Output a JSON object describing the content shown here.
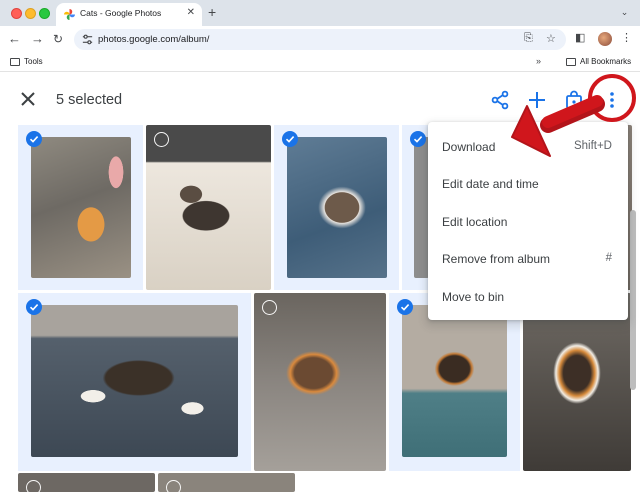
{
  "browser": {
    "tab_title": "Cats - Google Photos",
    "url": "photos.google.com/album/",
    "bookmarks": [
      {
        "label": "Tools"
      },
      {
        "label": "All Bookmarks"
      }
    ]
  },
  "selection_bar": {
    "count_label": "5 selected"
  },
  "menu": {
    "items": [
      {
        "label": "Download",
        "shortcut": "Shift+D"
      },
      {
        "label": "Edit date and time",
        "shortcut": ""
      },
      {
        "label": "Edit location",
        "shortcut": ""
      },
      {
        "label": "Remove from album",
        "shortcut": "#"
      },
      {
        "label": "Move to bin",
        "shortcut": ""
      }
    ]
  },
  "colors": {
    "accent": "#1a73e8",
    "annotation": "#d0161c",
    "selected_tile_bg": "#e8f0fe"
  },
  "icons": {
    "close": "close-icon",
    "share": "share-icon",
    "add": "add-icon",
    "shopping": "shopping-bag-icon",
    "more": "more-vert-icon"
  }
}
